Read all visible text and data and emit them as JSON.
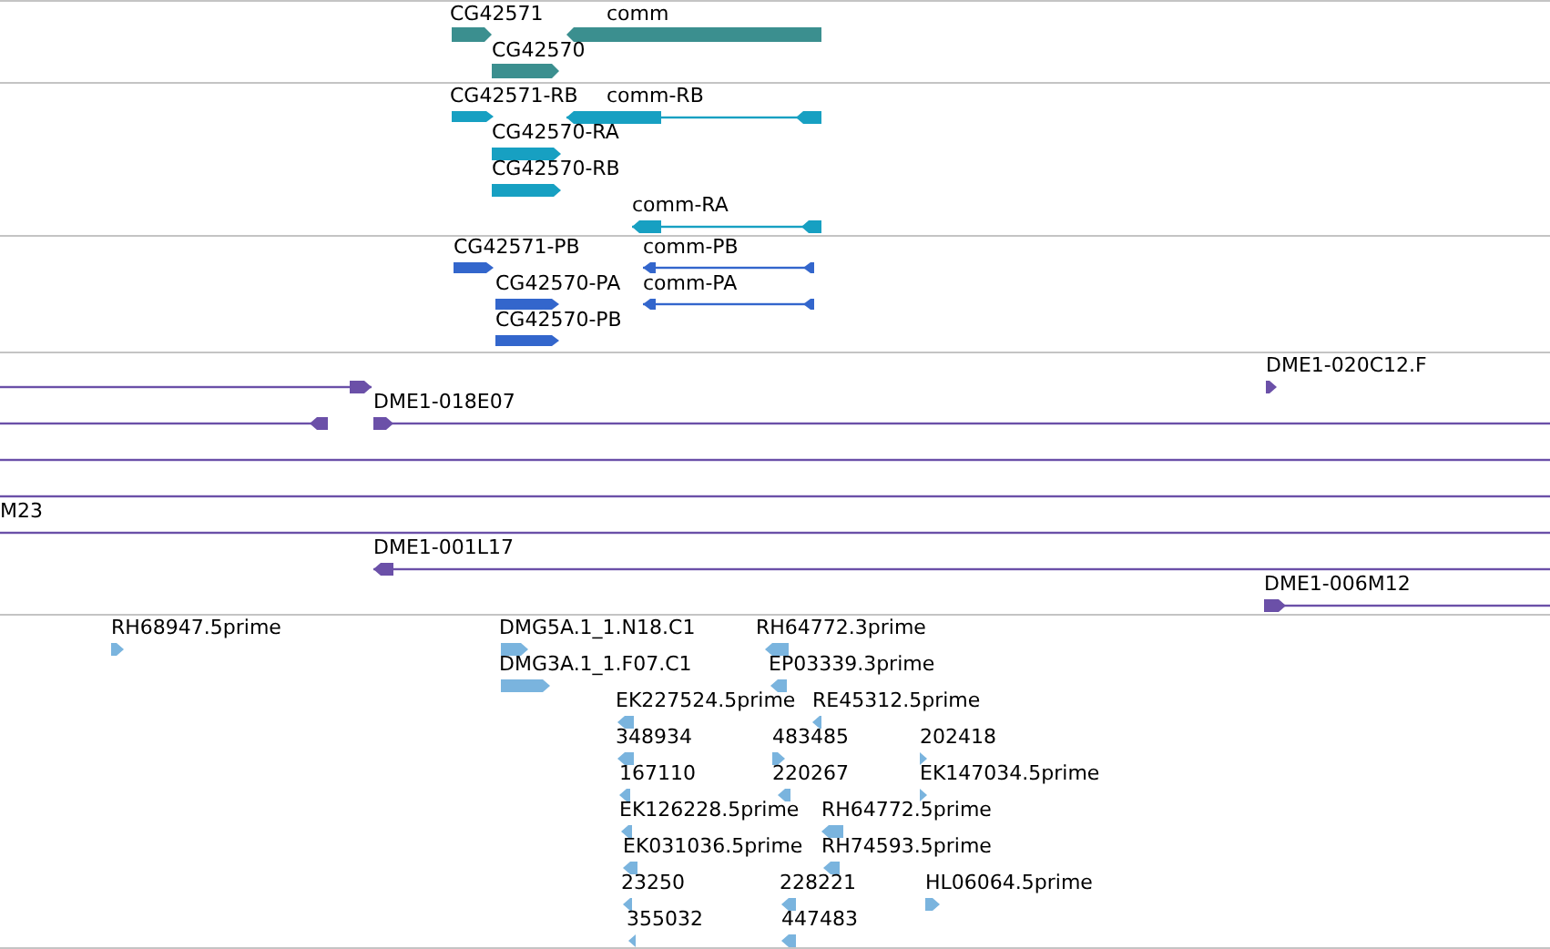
{
  "tracks": [
    {
      "color": "#3b8f8f",
      "features": [
        {
          "label": "CG42571",
          "kind": "block",
          "reverse": false
        },
        {
          "label": "comm",
          "kind": "block",
          "reverse": true
        },
        {
          "label": "CG42570",
          "kind": "block",
          "reverse": false
        }
      ]
    },
    {
      "color": "#17a0c2",
      "features": [
        {
          "label": "CG42571-RB",
          "kind": "block",
          "reverse": false
        },
        {
          "label": "comm-RB",
          "kind": "line",
          "reverse": true
        },
        {
          "label": "CG42570-RA",
          "kind": "block",
          "reverse": false
        },
        {
          "label": "CG42570-RB",
          "kind": "block",
          "reverse": false
        },
        {
          "label": "comm-RA",
          "kind": "line",
          "reverse": true
        }
      ]
    },
    {
      "color": "#3366cc",
      "features": [
        {
          "label": "CG42571-PB",
          "kind": "block",
          "reverse": false
        },
        {
          "label": "comm-PB",
          "kind": "line",
          "reverse": true
        },
        {
          "label": "CG42570-PA",
          "kind": "block",
          "reverse": false
        },
        {
          "label": "comm-PA",
          "kind": "line",
          "reverse": true
        },
        {
          "label": "CG42570-PB",
          "kind": "block",
          "reverse": false
        }
      ]
    },
    {
      "color": "#6b50a8",
      "features": [
        {
          "kind": "line",
          "reverse": false
        },
        {
          "label": "DME1-020C12.F",
          "kind": "block",
          "reverse": false
        },
        {
          "kind": "line",
          "reverse": true
        },
        {
          "label": "DME1-018E07",
          "kind": "line",
          "reverse": false
        },
        {
          "kind": "line"
        },
        {
          "kind": "line"
        },
        {
          "label": "M23",
          "kind": "line"
        },
        {
          "label": "DME1-001L17",
          "kind": "line",
          "reverse": true
        },
        {
          "label": "DME1-006M12",
          "kind": "line",
          "reverse": false
        }
      ]
    },
    {
      "color": "#7ab4de",
      "features": [
        {
          "label": "RH68947.5prime",
          "kind": "block",
          "reverse": false
        },
        {
          "label": "DMG5A.1_1.N18.C1",
          "kind": "block",
          "reverse": false
        },
        {
          "label": "RH64772.3prime",
          "kind": "block",
          "reverse": true
        },
        {
          "label": "DMG3A.1_1.F07.C1",
          "kind": "block",
          "reverse": false
        },
        {
          "label": "EP03339.3prime",
          "kind": "block",
          "reverse": true
        },
        {
          "label": "EK227524.5prime",
          "kind": "block",
          "reverse": true
        },
        {
          "label": "RE45312.5prime",
          "kind": "block",
          "reverse": true
        },
        {
          "label": "348934",
          "kind": "block",
          "reverse": true
        },
        {
          "label": "483485",
          "kind": "block",
          "reverse": false
        },
        {
          "label": "202418",
          "kind": "block",
          "reverse": false
        },
        {
          "label": "167110",
          "kind": "block",
          "reverse": true
        },
        {
          "label": "220267",
          "kind": "block",
          "reverse": true
        },
        {
          "label": "EK147034.5prime",
          "kind": "block",
          "reverse": false
        },
        {
          "label": "EK126228.5prime",
          "kind": "block",
          "reverse": true
        },
        {
          "label": "RH64772.5prime",
          "kind": "block",
          "reverse": true
        },
        {
          "label": "EK031036.5prime",
          "kind": "block",
          "reverse": true
        },
        {
          "label": "RH74593.5prime",
          "kind": "block",
          "reverse": true
        },
        {
          "label": "23250",
          "kind": "block",
          "reverse": true
        },
        {
          "label": "228221",
          "kind": "block",
          "reverse": true
        },
        {
          "label": "HL06064.5prime",
          "kind": "block",
          "reverse": false
        },
        {
          "label": "355032",
          "kind": "block",
          "reverse": true
        },
        {
          "label": "447483",
          "kind": "block",
          "reverse": true
        }
      ]
    }
  ]
}
